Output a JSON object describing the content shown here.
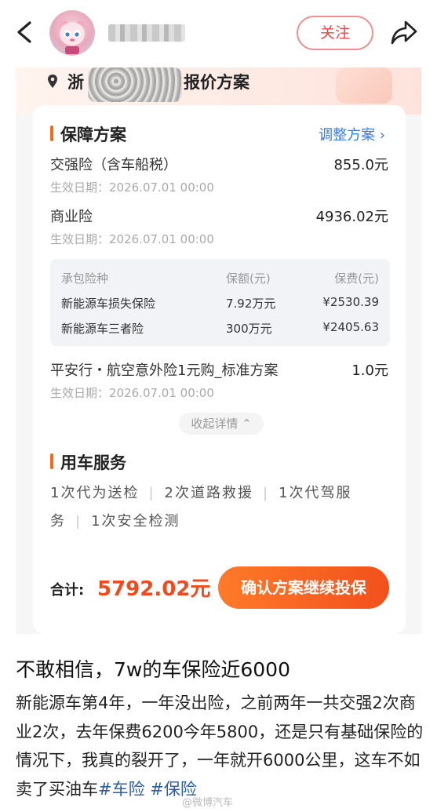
{
  "nav": {
    "follow_label": "关注",
    "back_icon": "back-arrow-icon",
    "share_icon": "share-icon"
  },
  "quote": {
    "plate_prefix": "浙",
    "title_suffix": "报价方案",
    "coverage": {
      "section_title": "保障方案",
      "adjust_label": "调整方案 ›",
      "items": [
        {
          "name": "交强险（含车船税）",
          "amount": "855.0元",
          "date": "生效日期：2026.07.01 00:00"
        },
        {
          "name": "商业险",
          "amount": "4936.02元",
          "date": "生效日期：2026.07.01 00:00"
        }
      ],
      "table": {
        "headers": [
          "承包险种",
          "保额(元)",
          "保费(元)"
        ],
        "rows": [
          [
            "新能源车损失保险",
            "7.92万元",
            "¥2530.39"
          ],
          [
            "新能源车三者险",
            "300万元",
            "¥2405.63"
          ]
        ]
      },
      "extra": {
        "name": "平安行・航空意外险1元购_标准方案",
        "amount": "1.0元",
        "date": "生效日期：2026.07.01 00:00"
      },
      "collapse_label": "收起详情 ⌃"
    },
    "services": {
      "section_title": "用车服务",
      "line1": [
        "1次代为送检",
        "2次道路救援",
        "1次代驾服"
      ],
      "line2": [
        "务",
        "1次安全检测"
      ]
    },
    "total_label": "合计:",
    "total_value": "5792.02元",
    "confirm_label": "确认方案继续投保"
  },
  "post": {
    "title": "不敢相信，7w的车保险近6000",
    "body": "新能源车第4年，一年没出险，之前两年一共交强2次商业2次，去年保费6200今年5800，还是只有基础保险的情况下，我真的裂开了，一年就开6000公里，这车不如卖了买油车",
    "tags": [
      "#车险",
      "#保险"
    ],
    "watermark": "@微博汽车"
  },
  "colors": {
    "accent": "#f26a1b",
    "price": "#f04a1e",
    "link": "#3d7bd6",
    "follow": "#e94848"
  }
}
